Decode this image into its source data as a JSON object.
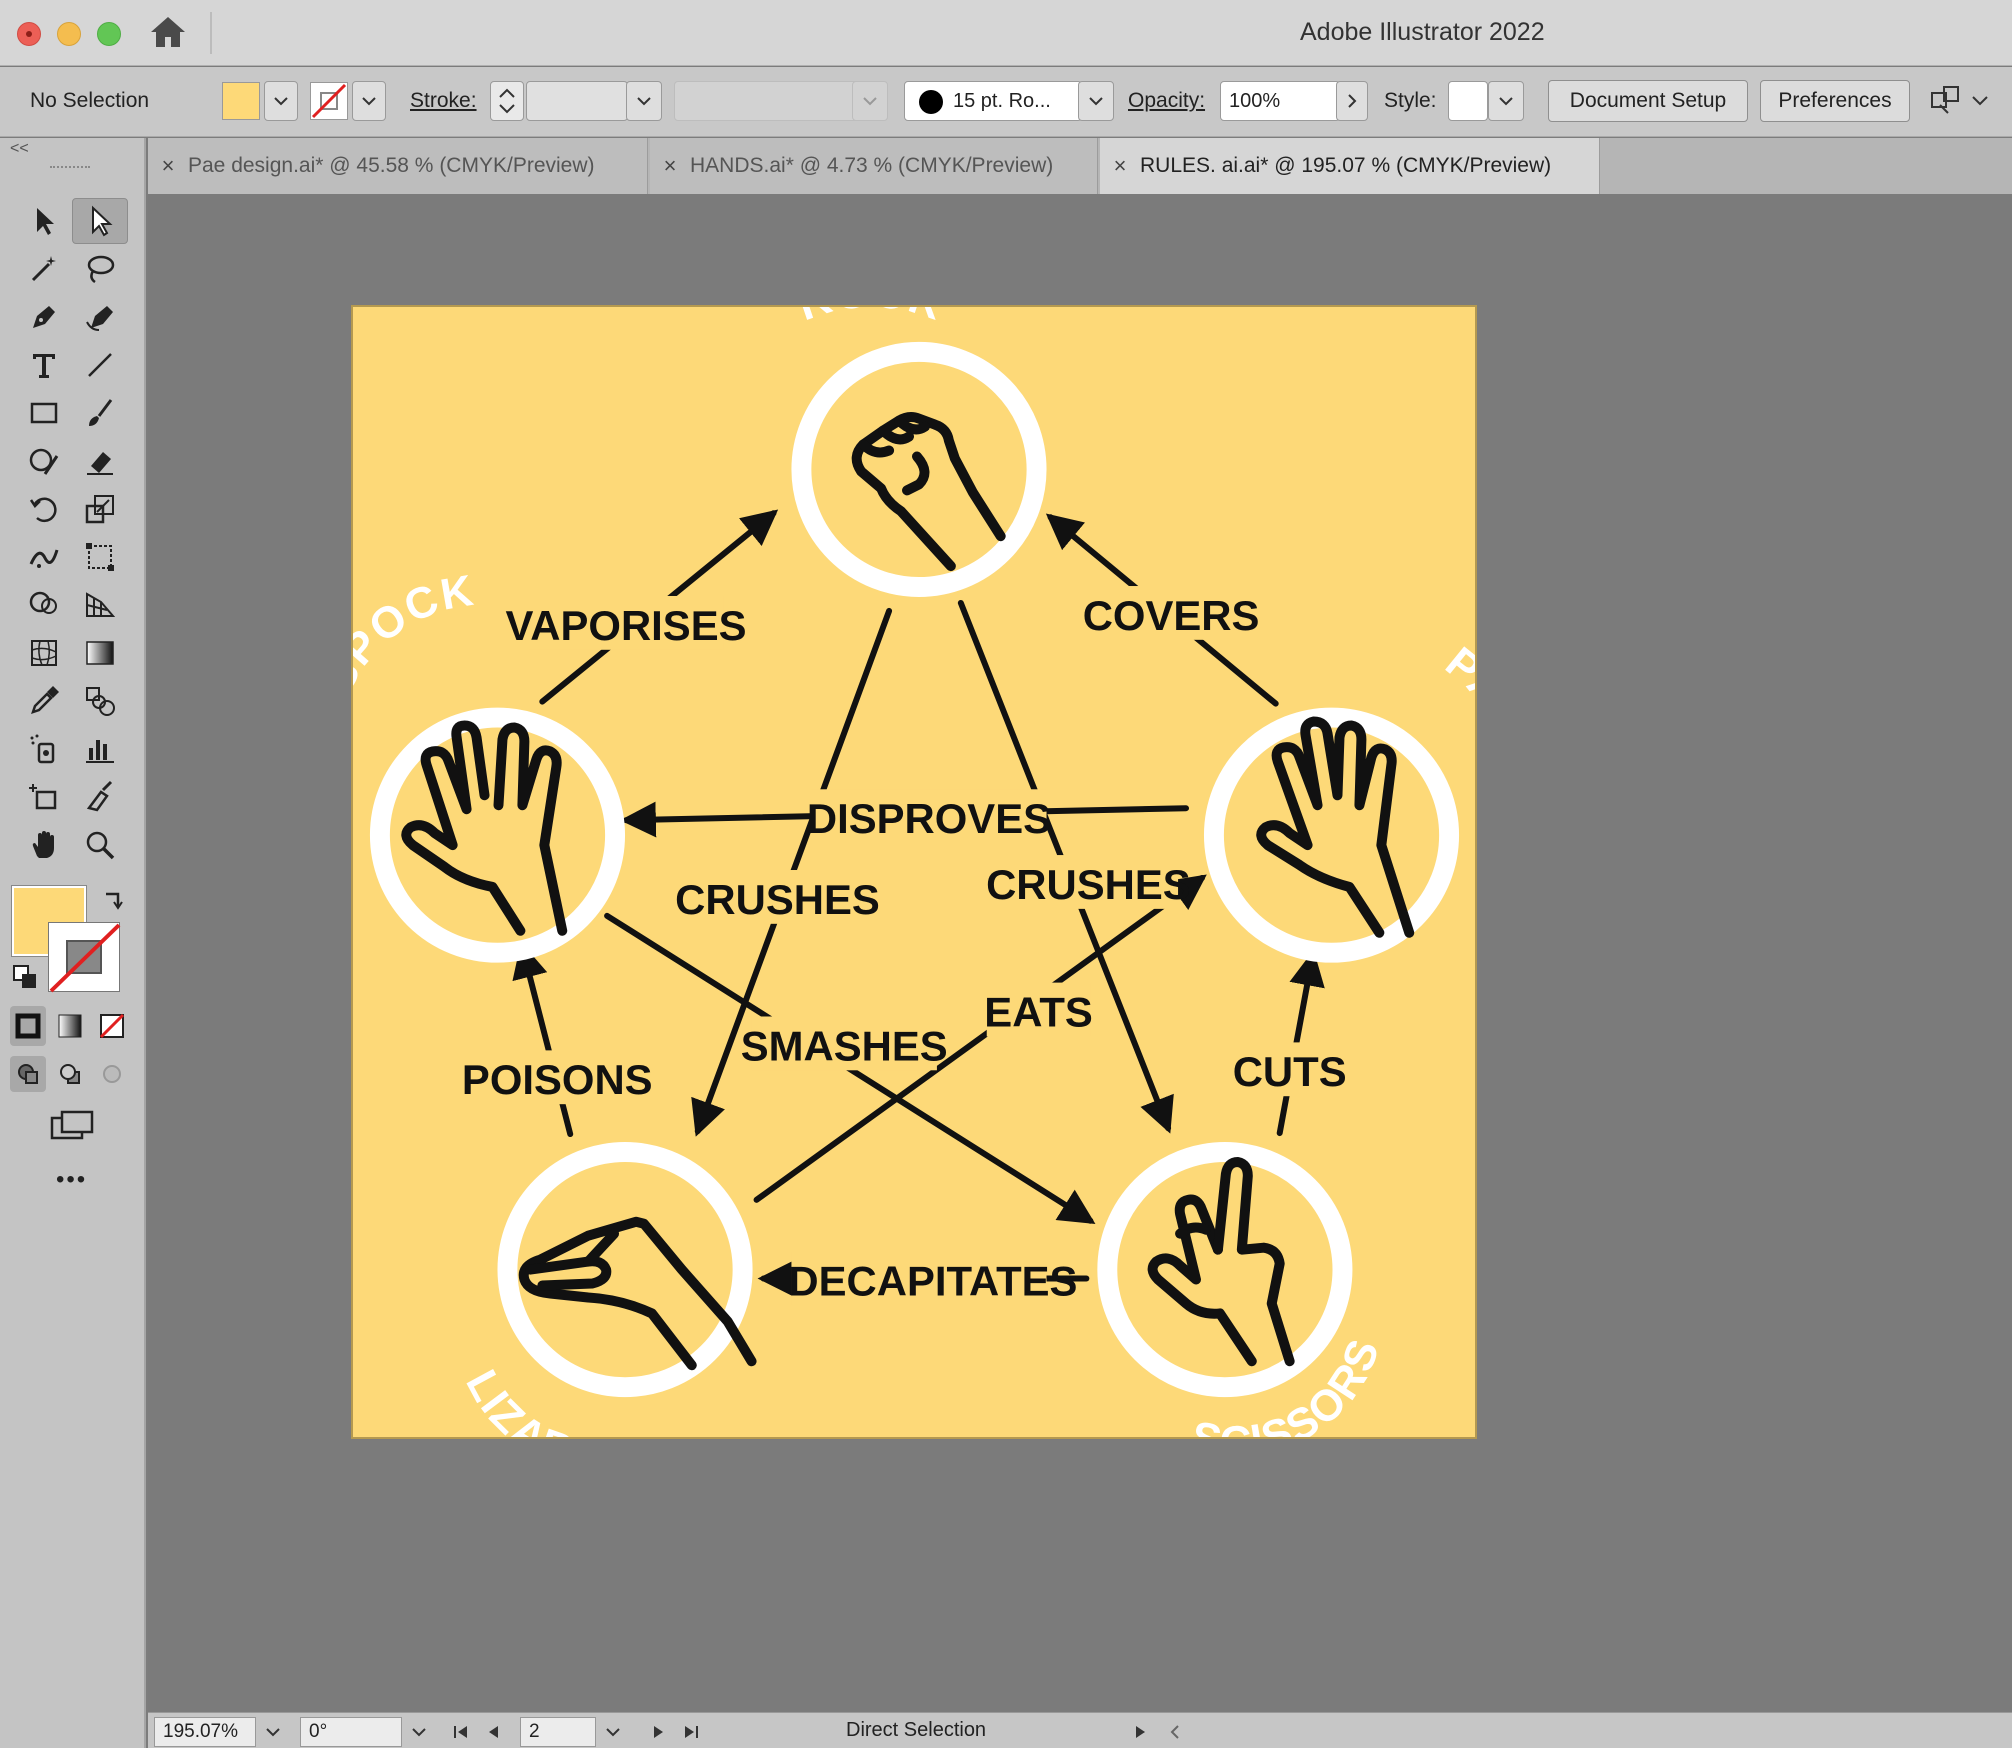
{
  "window": {
    "title": "Adobe Illustrator 2022"
  },
  "control_bar": {
    "selection_label": "No Selection",
    "fill_color": "#fdd978",
    "stroke_label": "Stroke:",
    "brush_label": "15 pt. Ro...",
    "opacity_label": "Opacity:",
    "opacity_value": "100%",
    "style_label": "Style:",
    "document_setup_button": "Document Setup",
    "preferences_button": "Preferences"
  },
  "tabs": [
    {
      "label": "Pae design.ai* @ 45.58 % (CMYK/Preview)",
      "active": false
    },
    {
      "label": "HANDS.ai* @ 4.73 % (CMYK/Preview)",
      "active": false
    },
    {
      "label": "RULES. ai.ai* @ 195.07 % (CMYK/Preview)",
      "active": true
    }
  ],
  "tools": {
    "collapse": "<<",
    "more": "•••"
  },
  "artwork": {
    "background_color": "#fdd978",
    "nodes": [
      {
        "label": "ROCK",
        "icon": "fist-icon"
      },
      {
        "label": "PAPER",
        "icon": "open-hand-icon"
      },
      {
        "label": "SCISSORS",
        "icon": "peace-sign-icon"
      },
      {
        "label": "LIZARD",
        "icon": "lizard-hand-icon"
      },
      {
        "label": "SPOCK",
        "icon": "vulcan-salute-icon"
      }
    ],
    "verbs": {
      "vaporises": "VAPORISES",
      "covers": "COVERS",
      "disproves": "DISPROVES",
      "crushes_left": "CRUSHES",
      "crushes_right": "CRUSHES",
      "smashes": "SMASHES",
      "eats": "EATS",
      "poisons": "POISONS",
      "cuts": "CUTS",
      "decapitates": "DECAPITATES"
    }
  },
  "status_bar": {
    "zoom": "195.07%",
    "rotation": "0°",
    "artboard_number": "2",
    "current_tool": "Direct Selection"
  }
}
